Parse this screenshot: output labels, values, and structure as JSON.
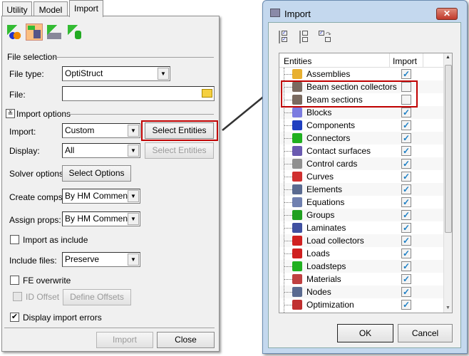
{
  "left_panel": {
    "tabs": [
      {
        "label": "Utility",
        "active": false
      },
      {
        "label": "Model",
        "active": false
      },
      {
        "label": "Import",
        "active": true
      }
    ],
    "toolbar_icons": [
      "import-model-icon",
      "import-geometry-mesh-icon",
      "import-surface-icon",
      "import-connectors-icon"
    ],
    "file_selection": "File selection",
    "file_type_label": "File type:",
    "file_type_value": "OptiStruct",
    "file_label": "File:",
    "file_value": "",
    "import_options": "Import options",
    "import_label": "Import:",
    "import_value": "Custom",
    "select_entities": "Select Entities",
    "display_label": "Display:",
    "display_value": "All",
    "select_entities_disabled": "Select Entities",
    "solver_options_label": "Solver options:",
    "select_options": "Select Options",
    "create_comps_label": "Create comps:",
    "create_comps_value": "By HM Comments",
    "assign_props_label": "Assign props:",
    "assign_props_value": "By HM Comments",
    "import_as_include": "Import as include",
    "import_as_include_checked": false,
    "include_files_label": "Include files:",
    "include_files_value": "Preserve",
    "fe_overwrite": "FE overwrite",
    "fe_overwrite_checked": false,
    "id_offset": "ID Offset",
    "id_offset_checked": false,
    "define_offsets": "Define Offsets",
    "display_import_errors": "Display import errors",
    "display_import_errors_checked": true,
    "import_button": "Import",
    "close_button": "Close"
  },
  "dialog": {
    "title": "Import",
    "toolbar_icons": [
      "check-all-icon",
      "uncheck-all-icon",
      "reverse-selection-icon"
    ],
    "columns": [
      "Entities",
      "Import"
    ],
    "rows": [
      {
        "name": "Assemblies",
        "checked": true,
        "color": "#e8b030"
      },
      {
        "name": "Beam section collectors",
        "checked": false,
        "color": "#7a6a60"
      },
      {
        "name": "Beam sections",
        "checked": false,
        "color": "#7a6a60"
      },
      {
        "name": "Blocks",
        "checked": true,
        "color": "#7c7ce0"
      },
      {
        "name": "Components",
        "checked": true,
        "color": "#2040c0"
      },
      {
        "name": "Connectors",
        "checked": true,
        "color": "#20b020"
      },
      {
        "name": "Contact surfaces",
        "checked": true,
        "color": "#6a5ab0"
      },
      {
        "name": "Control cards",
        "checked": true,
        "color": "#909090"
      },
      {
        "name": "Curves",
        "checked": true,
        "color": "#d03030"
      },
      {
        "name": "Elements",
        "checked": true,
        "color": "#5a6a90"
      },
      {
        "name": "Equations",
        "checked": true,
        "color": "#7080b0"
      },
      {
        "name": "Groups",
        "checked": true,
        "color": "#20a020"
      },
      {
        "name": "Laminates",
        "checked": true,
        "color": "#4050a0"
      },
      {
        "name": "Load collectors",
        "checked": true,
        "color": "#d02020"
      },
      {
        "name": "Loads",
        "checked": true,
        "color": "#d02020"
      },
      {
        "name": "Loadsteps",
        "checked": true,
        "color": "#20b020"
      },
      {
        "name": "Materials",
        "checked": true,
        "color": "#c04040"
      },
      {
        "name": "Nodes",
        "checked": true,
        "color": "#5a6a90"
      },
      {
        "name": "Optimization",
        "checked": true,
        "color": "#c03030"
      }
    ],
    "ok_button": "OK",
    "cancel_button": "Cancel"
  },
  "colors": {
    "highlight": "#c00000",
    "check": "#1c7fc4"
  }
}
